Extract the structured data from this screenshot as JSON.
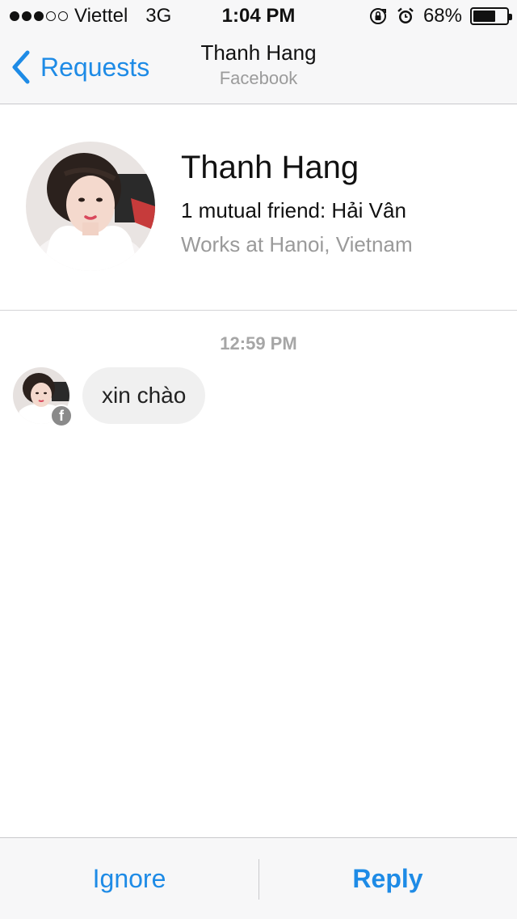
{
  "status_bar": {
    "carrier": "Viettel",
    "network": "3G",
    "time": "1:04 PM",
    "battery_text": "68%",
    "battery_level": 0.68,
    "signal_bars_filled": 3,
    "signal_bars_total": 5
  },
  "nav": {
    "back_label": "Requests",
    "title": "Thanh Hang",
    "subtitle": "Facebook"
  },
  "profile": {
    "name": "Thanh Hang",
    "mutual": "1 mutual friend: Hải Vân",
    "work": "Works at Hanoi, Vietnam"
  },
  "conversation": {
    "timestamp": "12:59 PM",
    "messages": [
      {
        "text": "xin chào"
      }
    ]
  },
  "actions": {
    "ignore_label": "Ignore",
    "reply_label": "Reply"
  },
  "colors": {
    "accent": "#1e8be6",
    "bubble": "#f0f0f0",
    "secondary_text": "#9b9b9b"
  }
}
